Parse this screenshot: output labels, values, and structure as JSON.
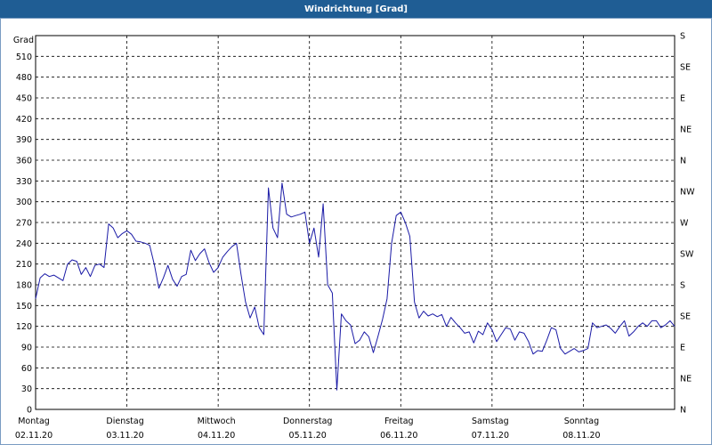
{
  "window": {
    "title": "Windrichtung [Grad]"
  },
  "colors": {
    "titlebar": "#1f5d94",
    "line": "#1a1aa6",
    "grid": "#000000"
  },
  "chart_data": {
    "type": "line",
    "title": "Windrichtung [Grad]",
    "ylabel": "Grad",
    "ylim": [
      0,
      540
    ],
    "yticks": [
      0,
      30,
      60,
      90,
      120,
      150,
      180,
      210,
      240,
      270,
      300,
      330,
      360,
      390,
      420,
      450,
      480,
      510
    ],
    "right_axis_labels": [
      "N",
      "NE",
      "E",
      "SE",
      "S",
      "SW",
      "W",
      "NW",
      "N",
      "NE",
      "E",
      "SE",
      "S"
    ],
    "xlim": [
      0,
      7
    ],
    "x_categories": [
      {
        "day": "Montag",
        "date": "02.11.20"
      },
      {
        "day": "Dienstag",
        "date": "03.11.20"
      },
      {
        "day": "Mittwoch",
        "date": "04.11.20"
      },
      {
        "day": "Donnerstag",
        "date": "05.11.20"
      },
      {
        "day": "Freitag",
        "date": "06.11.20"
      },
      {
        "day": "Samstag",
        "date": "07.11.20"
      },
      {
        "day": "Sonntag",
        "date": "08.11.20"
      }
    ],
    "grid": true,
    "series": [
      {
        "x": [
          0.0,
          0.05,
          0.1,
          0.15,
          0.2,
          0.25,
          0.3,
          0.35,
          0.4,
          0.45,
          0.5,
          0.55,
          0.6,
          0.65,
          0.7,
          0.75,
          0.8,
          0.85,
          0.9,
          0.95,
          1.0,
          1.05,
          1.1,
          1.15,
          1.2,
          1.25,
          1.3,
          1.35,
          1.4,
          1.45,
          1.5,
          1.55,
          1.6,
          1.65,
          1.7,
          1.75,
          1.8,
          1.85,
          1.9,
          1.95,
          2.0,
          2.05,
          2.1,
          2.15,
          2.2,
          2.25,
          2.3,
          2.35,
          2.4,
          2.45,
          2.5,
          2.55,
          2.6,
          2.65,
          2.7,
          2.75,
          2.8,
          2.85,
          2.9,
          2.95,
          3.0,
          3.05,
          3.1,
          3.15,
          3.2,
          3.25,
          3.3,
          3.35,
          3.4,
          3.45,
          3.5,
          3.55,
          3.6,
          3.65,
          3.7,
          3.75,
          3.8,
          3.85,
          3.9,
          3.95,
          4.0,
          4.05,
          4.1,
          4.15,
          4.2,
          4.25,
          4.3,
          4.35,
          4.4,
          4.45,
          4.5,
          4.55,
          4.6,
          4.65,
          4.7,
          4.75,
          4.8,
          4.85,
          4.9,
          4.95,
          5.0,
          5.05,
          5.1,
          5.15,
          5.2,
          5.25,
          5.3,
          5.35,
          5.4,
          5.45,
          5.5,
          5.55,
          5.6,
          5.65,
          5.7,
          5.75,
          5.8,
          5.85,
          5.9,
          5.95,
          6.0,
          6.05,
          6.1,
          6.15,
          6.2,
          6.25,
          6.3,
          6.35,
          6.4,
          6.45,
          6.5,
          6.55,
          6.6,
          6.65,
          6.7,
          6.75,
          6.8,
          6.85,
          6.9,
          6.95,
          7.0
        ],
        "y": [
          160,
          190,
          196,
          192,
          194,
          190,
          186,
          210,
          216,
          214,
          195,
          205,
          192,
          208,
          210,
          205,
          268,
          262,
          248,
          254,
          258,
          253,
          243,
          242,
          240,
          237,
          210,
          175,
          190,
          208,
          188,
          178,
          192,
          195,
          230,
          215,
          225,
          232,
          212,
          198,
          205,
          220,
          228,
          235,
          240,
          195,
          155,
          132,
          148,
          118,
          108,
          320,
          262,
          248,
          327,
          282,
          278,
          280,
          282,
          285,
          240,
          262,
          220,
          297,
          180,
          168,
          28,
          138,
          128,
          122,
          95,
          100,
          112,
          105,
          82,
          105,
          130,
          160,
          240,
          280,
          285,
          270,
          250,
          155,
          132,
          142,
          135,
          138,
          134,
          137,
          120,
          133,
          125,
          118,
          110,
          112,
          96,
          113,
          108,
          125,
          115,
          98,
          108,
          118,
          116,
          100,
          112,
          110,
          98,
          80,
          85,
          84,
          100,
          118,
          115,
          88,
          80,
          84,
          88,
          83,
          85,
          88,
          125,
          118,
          120,
          122,
          117,
          110,
          120,
          128,
          106,
          112,
          120,
          125,
          120,
          128,
          128,
          118,
          122,
          128,
          120
        ]
      }
    ]
  }
}
